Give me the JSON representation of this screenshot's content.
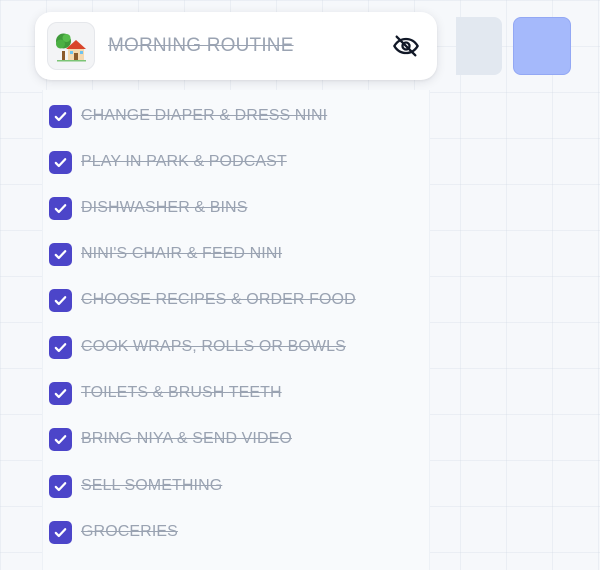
{
  "header": {
    "title": "MORNING ROUTINE",
    "emoji_icon": "house-with-tree-icon",
    "visibility_icon": "eye-off-icon"
  },
  "tasks": [
    {
      "label": "CHANGE DIAPER & DRESS NINI",
      "checked": true
    },
    {
      "label": "PLAY IN PARK & PODCAST",
      "checked": true
    },
    {
      "label": "DISHWASHER & BINS",
      "checked": true
    },
    {
      "label": "NINI'S CHAIR & FEED NINI",
      "checked": true
    },
    {
      "label": "CHOOSE RECIPES & ORDER FOOD",
      "checked": true
    },
    {
      "label": "COOK WRAPS, ROLLS OR BOWLS",
      "checked": true
    },
    {
      "label": "TOILETS & BRUSH TEETH",
      "checked": true
    },
    {
      "label": "BRING NIYA & SEND VIDEO",
      "checked": true
    },
    {
      "label": "SELL SOMETHING",
      "checked": true
    },
    {
      "label": "GROCERIES",
      "checked": true
    }
  ],
  "colors": {
    "checkbox": "#4c45c9",
    "completed_text": "#9aa3b2",
    "side_tile_gray": "#e2e8f0",
    "side_tile_blue": "#a5b9fb"
  }
}
